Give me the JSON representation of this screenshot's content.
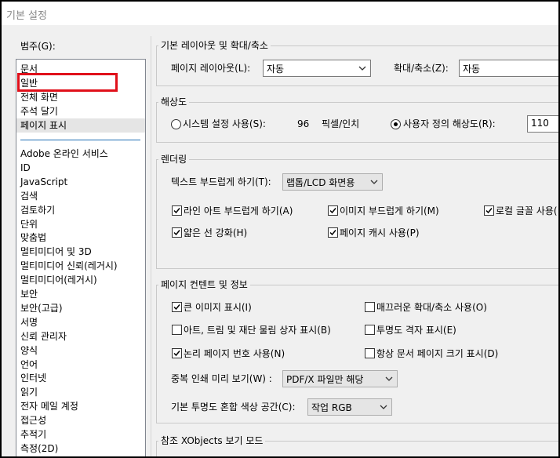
{
  "window": {
    "title": "기본 설정"
  },
  "categories": {
    "label": "범주(G):",
    "top_items": [
      "문서",
      "일반",
      "전체 화면",
      "주석 달기",
      "페이지 표시"
    ],
    "selected": "페이지 표시",
    "items": [
      "Adobe 온라인 서비스",
      "ID",
      "JavaScript",
      "검색",
      "검토하기",
      "단위",
      "맞춤법",
      "멀티미디어 및 3D",
      "멀티미디어 신뢰(레거시)",
      "멀티미디어(레거시)",
      "보안",
      "보안(고급)",
      "서명",
      "신뢰 관리자",
      "양식",
      "언어",
      "인터넷",
      "읽기",
      "전자 메일 계정",
      "접근성",
      "추적기",
      "측정(2D)"
    ]
  },
  "layout_group": {
    "title": "기본 레이아웃 및 확대/축소",
    "page_layout_label": "페이지 레이아웃(L):",
    "page_layout_value": "자동",
    "zoom_label": "확대/축소(Z):",
    "zoom_value": "자동"
  },
  "resolution_group": {
    "title": "해상도",
    "system_label": "시스템 설정 사용(S):",
    "system_value": "96",
    "system_unit": "픽셀/인치",
    "custom_label": "사용자 정의 해상도(R):",
    "custom_value": "110",
    "selected": "custom"
  },
  "rendering_group": {
    "title": "렌더링",
    "smooth_text_label": "텍스트 부드럽게 하기(T):",
    "smooth_text_value": "랩톱/LCD 화면용",
    "options": [
      {
        "label": "라인 아트 부드럽게 하기(A)",
        "checked": true
      },
      {
        "label": "이미지 부드럽게 하기(M)",
        "checked": true
      },
      {
        "label": "로컬 글꼴 사용(",
        "checked": true
      },
      {
        "label": "얇은 선 강화(H)",
        "checked": true
      },
      {
        "label": "페이지 캐시 사용(P)",
        "checked": true
      }
    ]
  },
  "content_group": {
    "title": "페이지 컨텐트 및 정보",
    "options": [
      {
        "label": "큰 이미지 표시(I)",
        "checked": true
      },
      {
        "label": "매끄러운 확대/축소 사용(O)",
        "checked": false
      },
      {
        "label": "아트, 트림 및 재단 물림 상자 표시(B)",
        "checked": false
      },
      {
        "label": "투명도 격자 표시(E)",
        "checked": false
      },
      {
        "label": "논리 페이지 번호 사용(N)",
        "checked": true
      },
      {
        "label": "항상 문서 페이지 크기 표시(D)",
        "checked": false
      }
    ],
    "overprint_label": "중복 인쇄 미리 보기(W) :",
    "overprint_value": "PDF/X 파일만 해당",
    "blend_label": "기본 투명도 혼합 색상 공간(C):",
    "blend_value": "작업 RGB"
  },
  "xobjects_group": {
    "title": "참조 XObjects 보기 모드"
  }
}
